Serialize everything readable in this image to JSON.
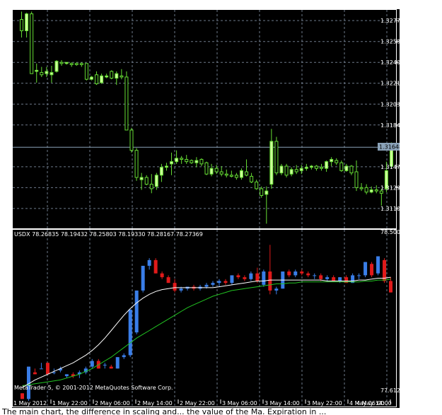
{
  "colors": {
    "background": "#000000",
    "grid": "#6e7a8a",
    "price_line": "#8aa2b8",
    "bull_upper": "#ffffff",
    "bear_upper": "#ffffff",
    "bull_candle_upper": "#ccff99",
    "wick_upper": "#66dd33",
    "bull_lower": "#3a7ee8",
    "bear_lower": "#e01a1a",
    "ma_fast": "#ffffff",
    "ma_slow": "#22c422",
    "label_bg_price": "#8aa2b8"
  },
  "upper_panel": {
    "price_levels": [
      "1.32770",
      "1.32585",
      "1.32400",
      "1.32215",
      "1.32030",
      "1.31845",
      "1.31475",
      "1.31290",
      "1.31105"
    ],
    "current_price": "1.31648"
  },
  "lower_panel": {
    "header": "USDX 78.26835 78.19432 78.25803 78.19330 78.28167 78.27369",
    "top_value": "78.50077",
    "bottom_value": "77.61269",
    "copyright": "MetaTrader 5, © 2001-2012 MetaQuotes Software Corp."
  },
  "time_axis": [
    "1 May 2012",
    "1 May 22:00",
    "2 May 06:00",
    "2 May 14:00",
    "2 May 22:00",
    "3 May 06:00",
    "3 May 14:00",
    "3 May 22:00",
    "4 May 06:00",
    "4 May 14:00"
  ],
  "caption": "The main chart, the difference in scaling and... the value of the Ma. Expiration in ...",
  "chart_data": [
    {
      "type": "candlestick",
      "title": "",
      "y_ticks": [
        1.3277,
        1.32585,
        1.324,
        1.32215,
        1.3203,
        1.31845,
        1.31475,
        1.3129,
        1.31105
      ],
      "current_price": 1.31648,
      "ylim": [
        1.3096,
        1.3284
      ],
      "candles": [
        [
          1.3278,
          1.3285,
          1.3262,
          1.3268
        ],
        [
          1.3268,
          1.3284,
          1.3262,
          1.3283
        ],
        [
          1.3283,
          1.3285,
          1.323,
          1.323
        ],
        [
          1.3232,
          1.3239,
          1.3222,
          1.3233
        ],
        [
          1.3231,
          1.3236,
          1.3227,
          1.3229
        ],
        [
          1.323,
          1.3236,
          1.3227,
          1.3232
        ],
        [
          1.3229,
          1.3237,
          1.3222,
          1.3231
        ],
        [
          1.3232,
          1.3242,
          1.3231,
          1.3241
        ],
        [
          1.324,
          1.3242,
          1.3237,
          1.3239
        ],
        [
          1.3239,
          1.324,
          1.3238,
          1.324
        ],
        [
          1.3239,
          1.324,
          1.3236,
          1.3238
        ],
        [
          1.3239,
          1.324,
          1.3237,
          1.3238
        ],
        [
          1.3239,
          1.324,
          1.3236,
          1.3238
        ],
        [
          1.3239,
          1.3239,
          1.3224,
          1.3225
        ],
        [
          1.3225,
          1.3228,
          1.3224,
          1.3227
        ],
        [
          1.3229,
          1.3232,
          1.322,
          1.3221
        ],
        [
          1.3222,
          1.323,
          1.3221,
          1.3228
        ],
        [
          1.3227,
          1.323,
          1.3226,
          1.3228
        ],
        [
          1.3232,
          1.3233,
          1.3225,
          1.3226
        ],
        [
          1.3226,
          1.3232,
          1.322,
          1.323
        ],
        [
          1.3228,
          1.3234,
          1.3225,
          1.3227
        ],
        [
          1.3227,
          1.3232,
          1.318,
          1.318
        ],
        [
          1.318,
          1.3182,
          1.316,
          1.3162
        ],
        [
          1.3162,
          1.3164,
          1.3135,
          1.3138
        ],
        [
          1.3136,
          1.3142,
          1.3127,
          1.3138
        ],
        [
          1.3138,
          1.314,
          1.3131,
          1.3132
        ],
        [
          1.3132,
          1.3141,
          1.3124,
          1.3128
        ],
        [
          1.313,
          1.3142,
          1.3127,
          1.314
        ],
        [
          1.314,
          1.315,
          1.3134,
          1.3147
        ],
        [
          1.3147,
          1.3151,
          1.3144,
          1.3148
        ],
        [
          1.315,
          1.316,
          1.314,
          1.3152
        ],
        [
          1.3152,
          1.3162,
          1.315,
          1.3155
        ],
        [
          1.3155,
          1.3157,
          1.315,
          1.3154
        ],
        [
          1.3154,
          1.3158,
          1.315,
          1.3152
        ],
        [
          1.3153,
          1.3154,
          1.315,
          1.3151
        ],
        [
          1.3151,
          1.3156,
          1.3147,
          1.3153
        ],
        [
          1.3154,
          1.3155,
          1.3148,
          1.315
        ],
        [
          1.3151,
          1.3152,
          1.314,
          1.3141
        ],
        [
          1.3141,
          1.315,
          1.3139,
          1.3146
        ],
        [
          1.3146,
          1.3149,
          1.3141,
          1.3143
        ],
        [
          1.3143,
          1.3148,
          1.3139,
          1.3141
        ],
        [
          1.3141,
          1.3145,
          1.3138,
          1.314
        ],
        [
          1.314,
          1.3144,
          1.3138,
          1.3139
        ],
        [
          1.314,
          1.3142,
          1.3136,
          1.3138
        ],
        [
          1.3138,
          1.3146,
          1.3136,
          1.3144
        ],
        [
          1.3143,
          1.3154,
          1.3139,
          1.314
        ],
        [
          1.3139,
          1.3142,
          1.3133,
          1.3134
        ],
        [
          1.3134,
          1.3136,
          1.3127,
          1.3128
        ],
        [
          1.3128,
          1.313,
          1.312,
          1.3122
        ],
        [
          1.3123,
          1.313,
          1.3097,
          1.3126
        ],
        [
          1.3132,
          1.3181,
          1.3128,
          1.317
        ],
        [
          1.317,
          1.3174,
          1.314,
          1.3142
        ],
        [
          1.3142,
          1.315,
          1.314,
          1.3148
        ],
        [
          1.3148,
          1.315,
          1.3138,
          1.314
        ],
        [
          1.3141,
          1.3147,
          1.3139,
          1.3145
        ],
        [
          1.3145,
          1.3149,
          1.3141,
          1.3143
        ],
        [
          1.3144,
          1.3149,
          1.3141,
          1.3146
        ],
        [
          1.3146,
          1.315,
          1.3144,
          1.3147
        ],
        [
          1.3147,
          1.3149,
          1.3145,
          1.3148
        ],
        [
          1.3148,
          1.3149,
          1.3144,
          1.3146
        ],
        [
          1.3147,
          1.315,
          1.3144,
          1.3146
        ],
        [
          1.3146,
          1.3153,
          1.3143,
          1.3152
        ],
        [
          1.3152,
          1.3156,
          1.3148,
          1.3154
        ],
        [
          1.3153,
          1.3155,
          1.3149,
          1.3151
        ],
        [
          1.3151,
          1.3153,
          1.3143,
          1.3144
        ],
        [
          1.3144,
          1.315,
          1.3143,
          1.3148
        ],
        [
          1.3148,
          1.3149,
          1.314,
          1.3142
        ],
        [
          1.3143,
          1.3153,
          1.3126,
          1.3129
        ],
        [
          1.3129,
          1.3133,
          1.3126,
          1.3128
        ],
        [
          1.3129,
          1.3132,
          1.3123,
          1.3125
        ],
        [
          1.3125,
          1.313,
          1.3124,
          1.3127
        ],
        [
          1.3127,
          1.3131,
          1.3124,
          1.3126
        ],
        [
          1.3126,
          1.3128,
          1.3113,
          1.3124
        ],
        [
          1.3128,
          1.3152,
          1.3125,
          1.3144
        ],
        [
          1.3148,
          1.3169,
          1.3146,
          1.3168
        ]
      ]
    },
    {
      "type": "candlestick",
      "title": "USDX",
      "ylim": [
        77.61269,
        78.50077
      ],
      "ma_fast": [
        77.69,
        77.71,
        77.73,
        77.745,
        77.76,
        77.775,
        77.79,
        77.805,
        77.82,
        77.84,
        77.86,
        77.885,
        77.915,
        77.95,
        77.99,
        78.03,
        78.07,
        78.105,
        78.135,
        78.16,
        78.18,
        78.195,
        78.205,
        78.21,
        78.215,
        78.215,
        78.215,
        78.215,
        78.215,
        78.215,
        78.215,
        78.22,
        78.225,
        78.23,
        78.235,
        78.24,
        78.245,
        78.25,
        78.25,
        78.255,
        78.255,
        78.255,
        78.255,
        78.255,
        78.255,
        78.255,
        78.255,
        78.255,
        78.25,
        78.25,
        78.25,
        78.25,
        78.25,
        78.255,
        78.255,
        78.26,
        78.265,
        78.265,
        78.27
      ],
      "ma_slow": [
        77.7,
        77.705,
        77.71,
        77.715,
        77.72,
        77.725,
        77.73,
        77.74,
        77.75,
        77.76,
        77.775,
        77.79,
        77.81,
        77.83,
        77.85,
        77.875,
        77.9,
        77.925,
        77.95,
        77.97,
        77.99,
        78.01,
        78.03,
        78.05,
        78.07,
        78.09,
        78.11,
        78.125,
        78.14,
        78.155,
        78.17,
        78.18,
        78.19,
        78.2,
        78.205,
        78.21,
        78.215,
        78.22,
        78.225,
        78.23,
        78.235,
        78.235,
        78.24,
        78.24,
        78.245,
        78.245,
        78.245,
        78.245,
        78.245,
        78.245,
        78.245,
        78.245,
        78.245,
        78.245,
        78.25,
        78.25,
        78.255,
        78.255,
        78.26
      ],
      "candles": [
        [
          77.66,
          77.66,
          77.63,
          77.63
        ],
        [
          77.63,
          77.8,
          77.62,
          77.8
        ],
        [
          77.77,
          77.79,
          77.76,
          77.76
        ],
        [
          77.79,
          77.82,
          77.79,
          77.79
        ],
        [
          77.82,
          77.82,
          77.76,
          77.76
        ],
        [
          77.77,
          77.79,
          77.76,
          77.77
        ],
        [
          77.78,
          77.8,
          77.77,
          77.79
        ],
        [
          77.75,
          77.76,
          77.74,
          77.76
        ],
        [
          77.76,
          77.77,
          77.74,
          77.75
        ],
        [
          77.76,
          77.78,
          77.74,
          77.77
        ],
        [
          77.77,
          77.8,
          77.76,
          77.79
        ],
        [
          77.8,
          77.84,
          77.79,
          77.83
        ],
        [
          77.83,
          77.84,
          77.79,
          77.79
        ],
        [
          77.81,
          77.82,
          77.79,
          77.81
        ],
        [
          77.8,
          77.81,
          77.79,
          77.79
        ],
        [
          77.79,
          77.85,
          77.79,
          77.85
        ],
        [
          77.85,
          77.87,
          77.84,
          77.86
        ],
        [
          77.86,
          78.1,
          77.85,
          78.1
        ],
        [
          77.98,
          78.2,
          77.97,
          78.2
        ],
        [
          78.2,
          78.33,
          78.19,
          78.33
        ],
        [
          78.33,
          78.37,
          78.31,
          78.36
        ],
        [
          78.36,
          78.37,
          78.29,
          78.29
        ],
        [
          78.29,
          78.3,
          78.26,
          78.27
        ],
        [
          78.27,
          78.28,
          78.24,
          78.24
        ],
        [
          78.24,
          78.26,
          78.19,
          78.2
        ],
        [
          78.2,
          78.22,
          78.19,
          78.21
        ],
        [
          78.21,
          78.22,
          78.2,
          78.22
        ],
        [
          78.22,
          78.23,
          78.2,
          78.21
        ],
        [
          78.21,
          78.23,
          78.2,
          78.22
        ],
        [
          78.22,
          78.24,
          78.21,
          78.23
        ],
        [
          78.23,
          78.25,
          78.22,
          78.24
        ],
        [
          78.24,
          78.26,
          78.22,
          78.25
        ],
        [
          78.25,
          78.26,
          78.23,
          78.24
        ],
        [
          78.24,
          78.28,
          78.23,
          78.28
        ],
        [
          78.28,
          78.29,
          78.26,
          78.27
        ],
        [
          78.27,
          78.28,
          78.25,
          78.26
        ],
        [
          78.26,
          78.3,
          78.25,
          78.29
        ],
        [
          78.29,
          78.32,
          78.24,
          78.25
        ],
        [
          78.23,
          78.31,
          78.22,
          78.3
        ],
        [
          78.3,
          78.44,
          78.18,
          78.2
        ],
        [
          78.2,
          78.22,
          78.18,
          78.21
        ],
        [
          78.21,
          78.3,
          78.21,
          78.3
        ],
        [
          78.3,
          78.31,
          78.27,
          78.28
        ],
        [
          78.28,
          78.31,
          78.27,
          78.3
        ],
        [
          78.3,
          78.31,
          78.28,
          78.29
        ],
        [
          78.29,
          78.3,
          78.27,
          78.28
        ],
        [
          78.28,
          78.29,
          78.26,
          78.28
        ],
        [
          78.28,
          78.29,
          78.25,
          78.26
        ],
        [
          78.26,
          78.28,
          78.25,
          78.27
        ],
        [
          78.27,
          78.28,
          78.25,
          78.25
        ],
        [
          78.25,
          78.27,
          78.24,
          78.27
        ],
        [
          78.27,
          78.28,
          78.24,
          78.24
        ],
        [
          78.24,
          78.29,
          78.24,
          78.28
        ],
        [
          78.28,
          78.29,
          78.26,
          78.28
        ],
        [
          78.28,
          78.35,
          78.27,
          78.35
        ],
        [
          78.34,
          78.35,
          78.27,
          78.28
        ],
        [
          78.29,
          78.38,
          78.28,
          78.38
        ],
        [
          78.36,
          78.37,
          78.24,
          78.25
        ],
        [
          78.25,
          78.27,
          78.19,
          78.19
        ]
      ]
    }
  ]
}
